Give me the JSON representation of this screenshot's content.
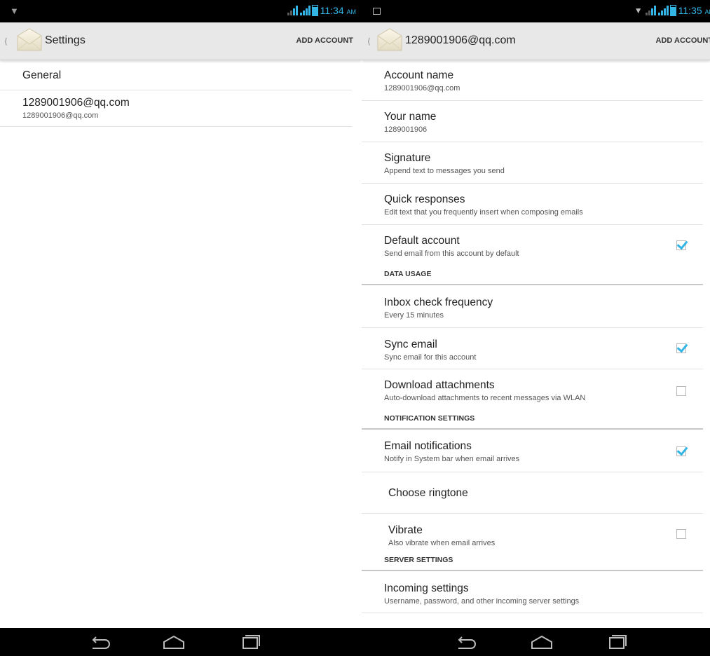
{
  "left": {
    "status": {
      "time": "11:34",
      "ampm": "AM"
    },
    "actionbar": {
      "title": "Settings",
      "action_label": "ADD ACCOUNT"
    },
    "items": [
      {
        "title": "General"
      },
      {
        "title": "1289001906@qq.com",
        "summary": "1289001906@qq.com"
      }
    ]
  },
  "right": {
    "status": {
      "time": "11:35",
      "ampm": "AM"
    },
    "actionbar": {
      "title": "1289001906@qq.com",
      "action_label": "ADD ACCOUNT"
    },
    "items": [
      {
        "title": "Account name",
        "summary": "1289001906@qq.com"
      },
      {
        "title": "Your name",
        "summary": "1289001906"
      },
      {
        "title": "Signature",
        "summary": "Append text to messages you send"
      },
      {
        "title": "Quick responses",
        "summary": "Edit text that you frequently insert when composing emails"
      },
      {
        "title": "Default account",
        "summary": "Send email from this account by default",
        "checked": true
      }
    ],
    "categories": {
      "data_usage": "DATA USAGE",
      "notification_settings": "NOTIFICATION SETTINGS",
      "server_settings": "SERVER SETTINGS"
    },
    "data_items": [
      {
        "title": "Inbox check frequency",
        "summary": "Every 15 minutes"
      },
      {
        "title": "Sync email",
        "summary": "Sync email for this account",
        "checked": true
      },
      {
        "title": "Download attachments",
        "summary": "Auto-download attachments to recent messages via WLAN",
        "checked": false
      }
    ],
    "notif_items": [
      {
        "title": "Email notifications",
        "summary": "Notify in System bar when email arrives",
        "checked": true
      },
      {
        "title": "Choose ringtone"
      },
      {
        "title": "Vibrate",
        "summary": "Also vibrate when email arrives",
        "checked": false
      }
    ],
    "server_items": [
      {
        "title": "Incoming settings",
        "summary": "Username, password, and other incoming server settings"
      }
    ]
  },
  "colors": {
    "accent": "#33b5e5",
    "actionbar": "#e8e8e8",
    "statusbar": "#000000"
  },
  "icons": {
    "app": "mail-envelope-icon",
    "back": "back-icon",
    "home": "home-icon",
    "recents": "recents-icon"
  }
}
